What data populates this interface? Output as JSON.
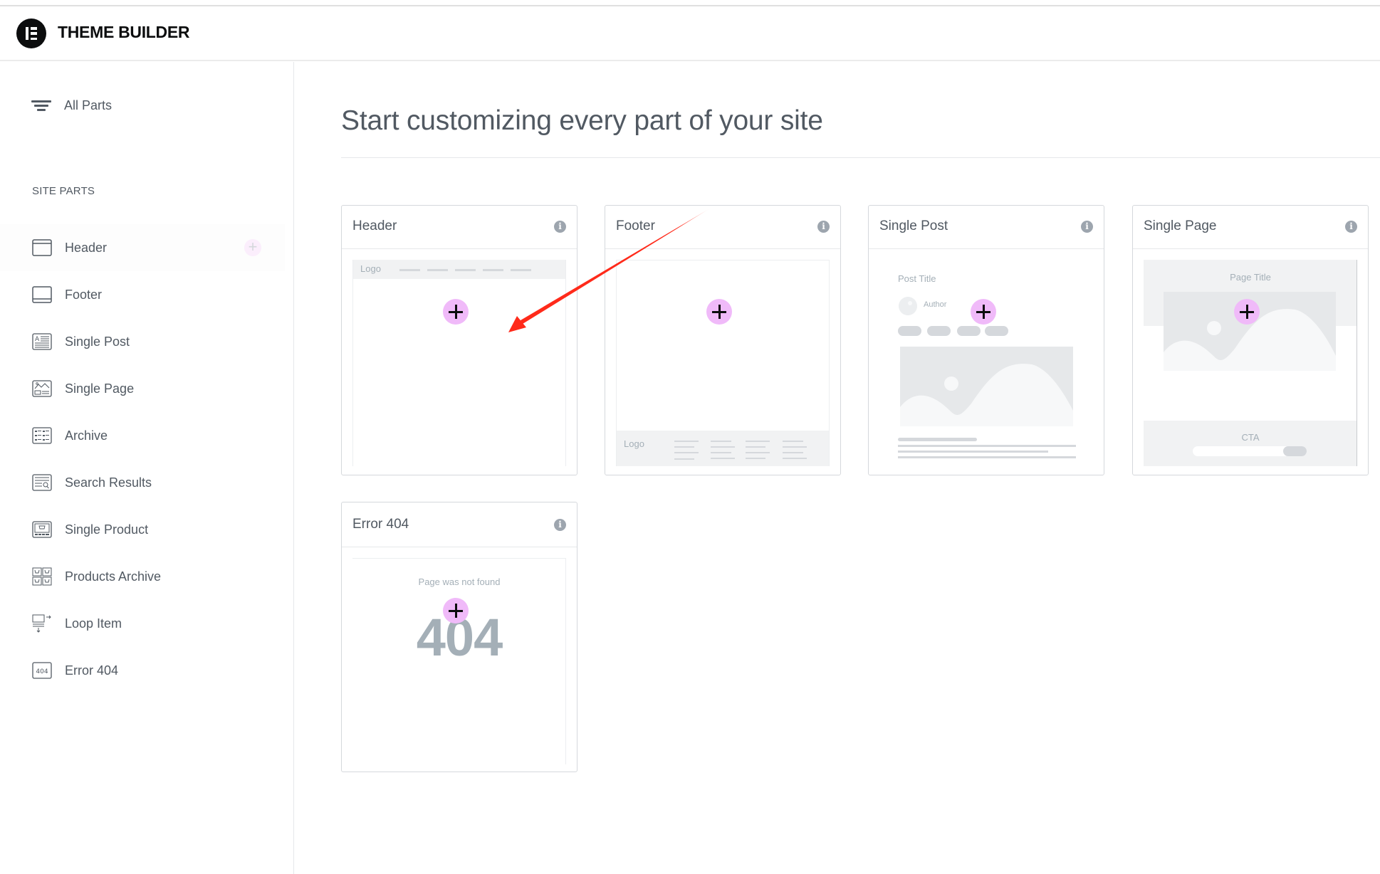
{
  "app": {
    "title": "THEME BUILDER",
    "logo_icon": "elementor-logo-icon"
  },
  "sidebar": {
    "all_parts_label": "All Parts",
    "all_parts_icon": "filter-icon",
    "section_label": "SITE PARTS",
    "items": [
      {
        "label": "Header",
        "icon": "header-layout-icon",
        "hovered": true
      },
      {
        "label": "Footer",
        "icon": "footer-layout-icon"
      },
      {
        "label": "Single Post",
        "icon": "single-post-icon"
      },
      {
        "label": "Single Page",
        "icon": "single-page-icon"
      },
      {
        "label": "Archive",
        "icon": "archive-grid-icon"
      },
      {
        "label": "Search Results",
        "icon": "search-results-icon"
      },
      {
        "label": "Single Product",
        "icon": "single-product-icon"
      },
      {
        "label": "Products Archive",
        "icon": "products-archive-icon"
      },
      {
        "label": "Loop Item",
        "icon": "loop-item-icon"
      },
      {
        "label": "Error 404",
        "icon": "error-404-icon",
        "icon_text": "404"
      }
    ]
  },
  "main": {
    "title": "Start customizing every part of your site",
    "cards": [
      {
        "title": "Header",
        "preview": {
          "logo": "Logo"
        }
      },
      {
        "title": "Footer",
        "preview": {
          "logo": "Logo"
        }
      },
      {
        "title": "Single Post",
        "preview": {
          "post_title": "Post Title",
          "author": "Author"
        }
      },
      {
        "title": "Single Page",
        "preview": {
          "page_title": "Page Title",
          "cta": "CTA"
        }
      },
      {
        "title": "Error 404",
        "preview": {
          "message": "Page was not found",
          "code": "404"
        }
      }
    ]
  },
  "colors": {
    "accent_add": "#f0baf9",
    "text": "#515962",
    "placeholder": "#a4afb7",
    "annotation_arrow": "#ff2a1a"
  }
}
